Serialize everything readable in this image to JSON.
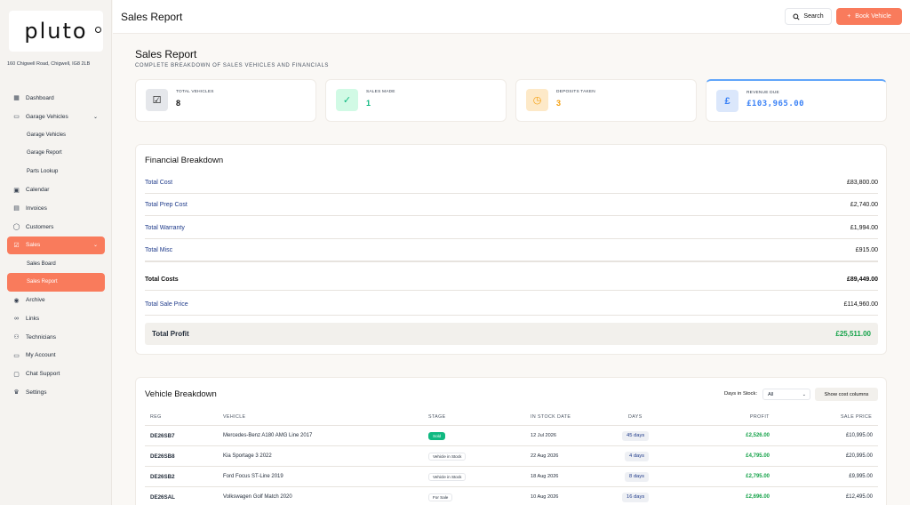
{
  "brand": {
    "logo": "pluto",
    "address": "160 Chigwell Road, Chigwell, IG8 2LB"
  },
  "nav": [
    {
      "label": "Dashboard",
      "icon": "grid-icon"
    },
    {
      "label": "Garage Vehicles",
      "icon": "monitor-icon",
      "expanded": true
    },
    {
      "label": "Garage Vehicles",
      "sub": true
    },
    {
      "label": "Garage Report",
      "sub": true
    },
    {
      "label": "Parts Lookup",
      "sub": true
    },
    {
      "label": "Calendar",
      "icon": "calendar-icon"
    },
    {
      "label": "Invoices",
      "icon": "invoice-icon"
    },
    {
      "label": "Customers",
      "icon": "user-icon"
    },
    {
      "label": "Sales",
      "icon": "check-square-icon",
      "active": true
    },
    {
      "label": "Sales Board",
      "sub": true
    },
    {
      "label": "Sales Report",
      "sub": true,
      "active": true
    },
    {
      "label": "Archive",
      "icon": "pin-icon"
    },
    {
      "label": "Links",
      "icon": "link-icon"
    },
    {
      "label": "Technicians",
      "icon": "users-icon"
    },
    {
      "label": "My Account",
      "icon": "card-icon"
    },
    {
      "label": "Chat Support",
      "icon": "chat-icon"
    },
    {
      "label": "Settings",
      "icon": "crown-icon"
    }
  ],
  "topbar": {
    "title": "Sales Report",
    "search": "Search",
    "book": "Book Vehicle"
  },
  "page": {
    "title": "Sales Report",
    "subtitle": "COMPLETE BREAKDOWN OF SALES VEHICLES AND FINANCIALS"
  },
  "stats": [
    {
      "label": "TOTAL VEHICLES",
      "value": "8",
      "icon": "check-box-icon",
      "color": "#111111",
      "bg": "#e5e7eb"
    },
    {
      "label": "SALES MADE",
      "value": "1",
      "icon": "check-circle-icon",
      "color": "#10b981",
      "bg": "#d1fae5"
    },
    {
      "label": "DEPOSITS TAKEN",
      "value": "3",
      "icon": "clock-icon",
      "color": "#f59e0b",
      "bg": "#fde9c8"
    },
    {
      "label": "REVENUE DUE",
      "value": "£103,965.00",
      "icon": "pound-icon",
      "color": "#3b82f6",
      "bg": "#dbe7fb"
    }
  ],
  "financial": {
    "title": "Financial Breakdown",
    "rows": [
      {
        "label": "Total Cost",
        "value": "£83,800.00"
      },
      {
        "label": "Total Prep Cost",
        "value": "£2,740.00"
      },
      {
        "label": "Total Warranty",
        "value": "£1,994.00"
      },
      {
        "label": "Total Misc",
        "value": "£915.00"
      },
      {
        "label": "Total Costs",
        "value": "£89,449.00"
      },
      {
        "label": "Total Sale Price",
        "value": "£114,960.00"
      }
    ],
    "profit_label": "Total Profit",
    "profit_value": "£25,511.00"
  },
  "vehicles": {
    "title": "Vehicle Breakdown",
    "filter_label": "Days in Stock:",
    "filter_value": "All",
    "cost_button": "Show cost columns",
    "headers": [
      "REG",
      "VEHICLE",
      "STAGE",
      "IN STOCK DATE",
      "DAYS",
      "PROFIT",
      "SALE PRICE"
    ],
    "rows": [
      {
        "reg": "DE26SB7",
        "vehicle": "Mercedes-Benz A180 AMG Line 2017",
        "stage": "Sold",
        "date": "12 Jul 2026",
        "days": "45 days",
        "profit": "£2,526.00",
        "price": "£10,995.00"
      },
      {
        "reg": "DE26SB8",
        "vehicle": "Kia Sportage 3 2022",
        "stage": "Vehicle in Stock",
        "date": "22 Aug 2026",
        "days": "4 days",
        "profit": "£4,795.00",
        "price": "£20,995.00"
      },
      {
        "reg": "DE26SB2",
        "vehicle": "Ford Focus ST-Line 2019",
        "stage": "Vehicle in Stock",
        "date": "18 Aug 2026",
        "days": "8 days",
        "profit": "£2,795.00",
        "price": "£9,995.00"
      },
      {
        "reg": "DE26SAL",
        "vehicle": "Volkswagen Golf Match 2020",
        "stage": "For Sale",
        "date": "10 Aug 2026",
        "days": "16 days",
        "profit": "£2,696.00",
        "price": "£12,495.00"
      }
    ]
  },
  "colors": {
    "accent": "#f97b5c",
    "profit_green": "#16a34a",
    "link_blue": "#1e3a8a"
  }
}
